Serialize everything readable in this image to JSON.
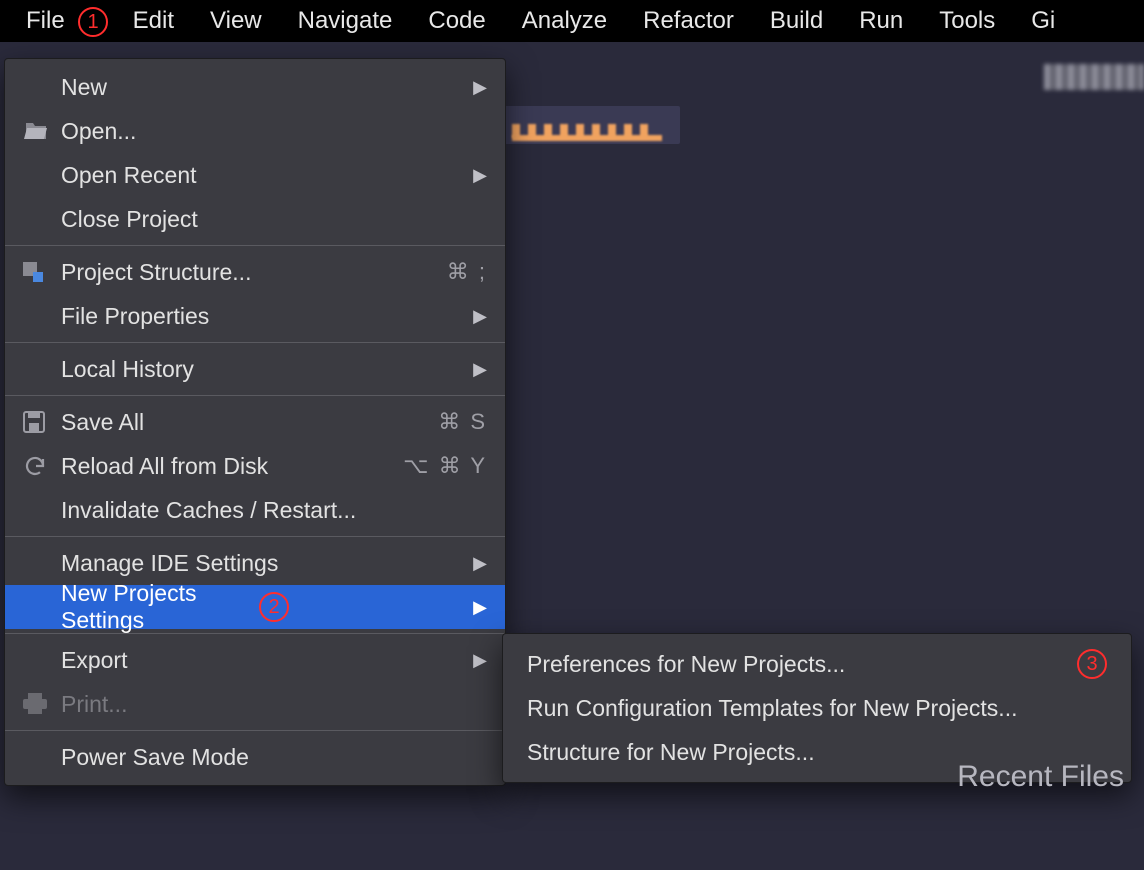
{
  "menubar": {
    "items": [
      "File",
      "Edit",
      "View",
      "Navigate",
      "Code",
      "Analyze",
      "Refactor",
      "Build",
      "Run",
      "Tools",
      "Gi"
    ]
  },
  "annotations": {
    "one": "1",
    "two": "2",
    "three": "3"
  },
  "fileMenu": {
    "new": "New",
    "open": "Open...",
    "openRecent": "Open Recent",
    "closeProject": "Close Project",
    "projectStructure": "Project Structure...",
    "fileProperties": "File Properties",
    "localHistory": "Local History",
    "saveAll": "Save All",
    "reloadAll": "Reload All from Disk",
    "invalidate": "Invalidate Caches / Restart...",
    "manageIDE": "Manage IDE Settings",
    "newProjectsSettings": "New Projects Settings",
    "export": "Export",
    "print": "Print...",
    "powerSave": "Power Save Mode",
    "shortcuts": {
      "projectStructure": "⌘ ;",
      "saveAll": "⌘ S",
      "reloadAll": "⌥ ⌘ Y"
    }
  },
  "submenu": {
    "preferences": "Preferences for New Projects...",
    "runConfig": "Run Configuration Templates for New Projects...",
    "structure": "Structure for New Projects..."
  },
  "rightPanel": {
    "recentFiles": "Recent Files"
  }
}
